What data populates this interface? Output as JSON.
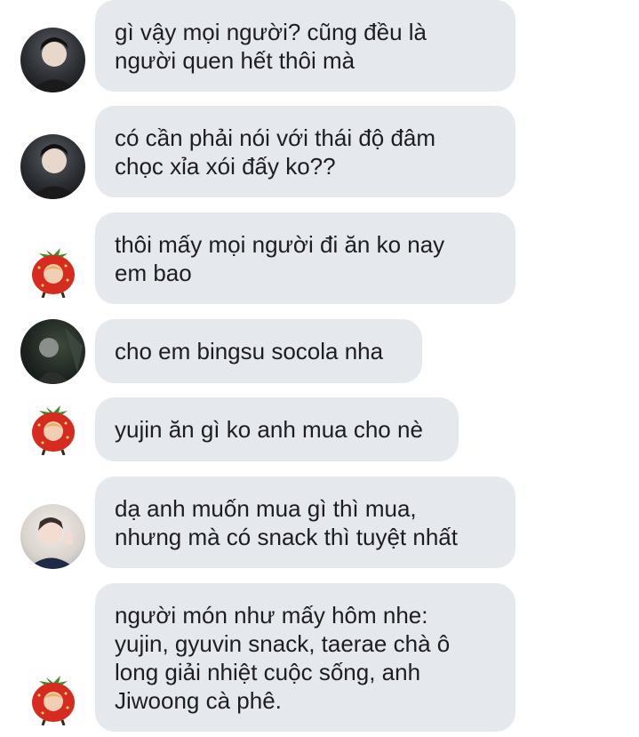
{
  "messages": [
    {
      "text": "gì vậy mọi người? cũng đều là\nngười quen hết thôi mà",
      "avatar": "person-dark-hair-avatar"
    },
    {
      "text": "có cần phải nói với thái độ đâm\nchọc xỉa xói đấy ko??",
      "avatar": "person-dark-hair-avatar"
    },
    {
      "text": "thôi mấy mọi người đi ăn ko nay\nem bao",
      "avatar": "strawberry-avatar"
    },
    {
      "text": "cho em bingsu socola nha",
      "avatar": "person-dark-photo-avatar"
    },
    {
      "text": "yujin ăn gì ko anh mua cho nè",
      "avatar": "strawberry-avatar"
    },
    {
      "text": "dạ anh muốn mua gì thì mua,\nnhưng mà có snack thì tuyệt nhất",
      "avatar": "person-light-avatar"
    },
    {
      "text": "người món như mấy hôm nhe:\nyujin, gyuvin snack, taerae chà ô\nlong giải nhiệt cuộc sống, anh\nJiwoong cà phê.",
      "avatar": "strawberry-avatar"
    }
  ],
  "colors": {
    "bubble": "#e5e8ed",
    "text": "#1c1e21",
    "background": "#ffffff"
  }
}
